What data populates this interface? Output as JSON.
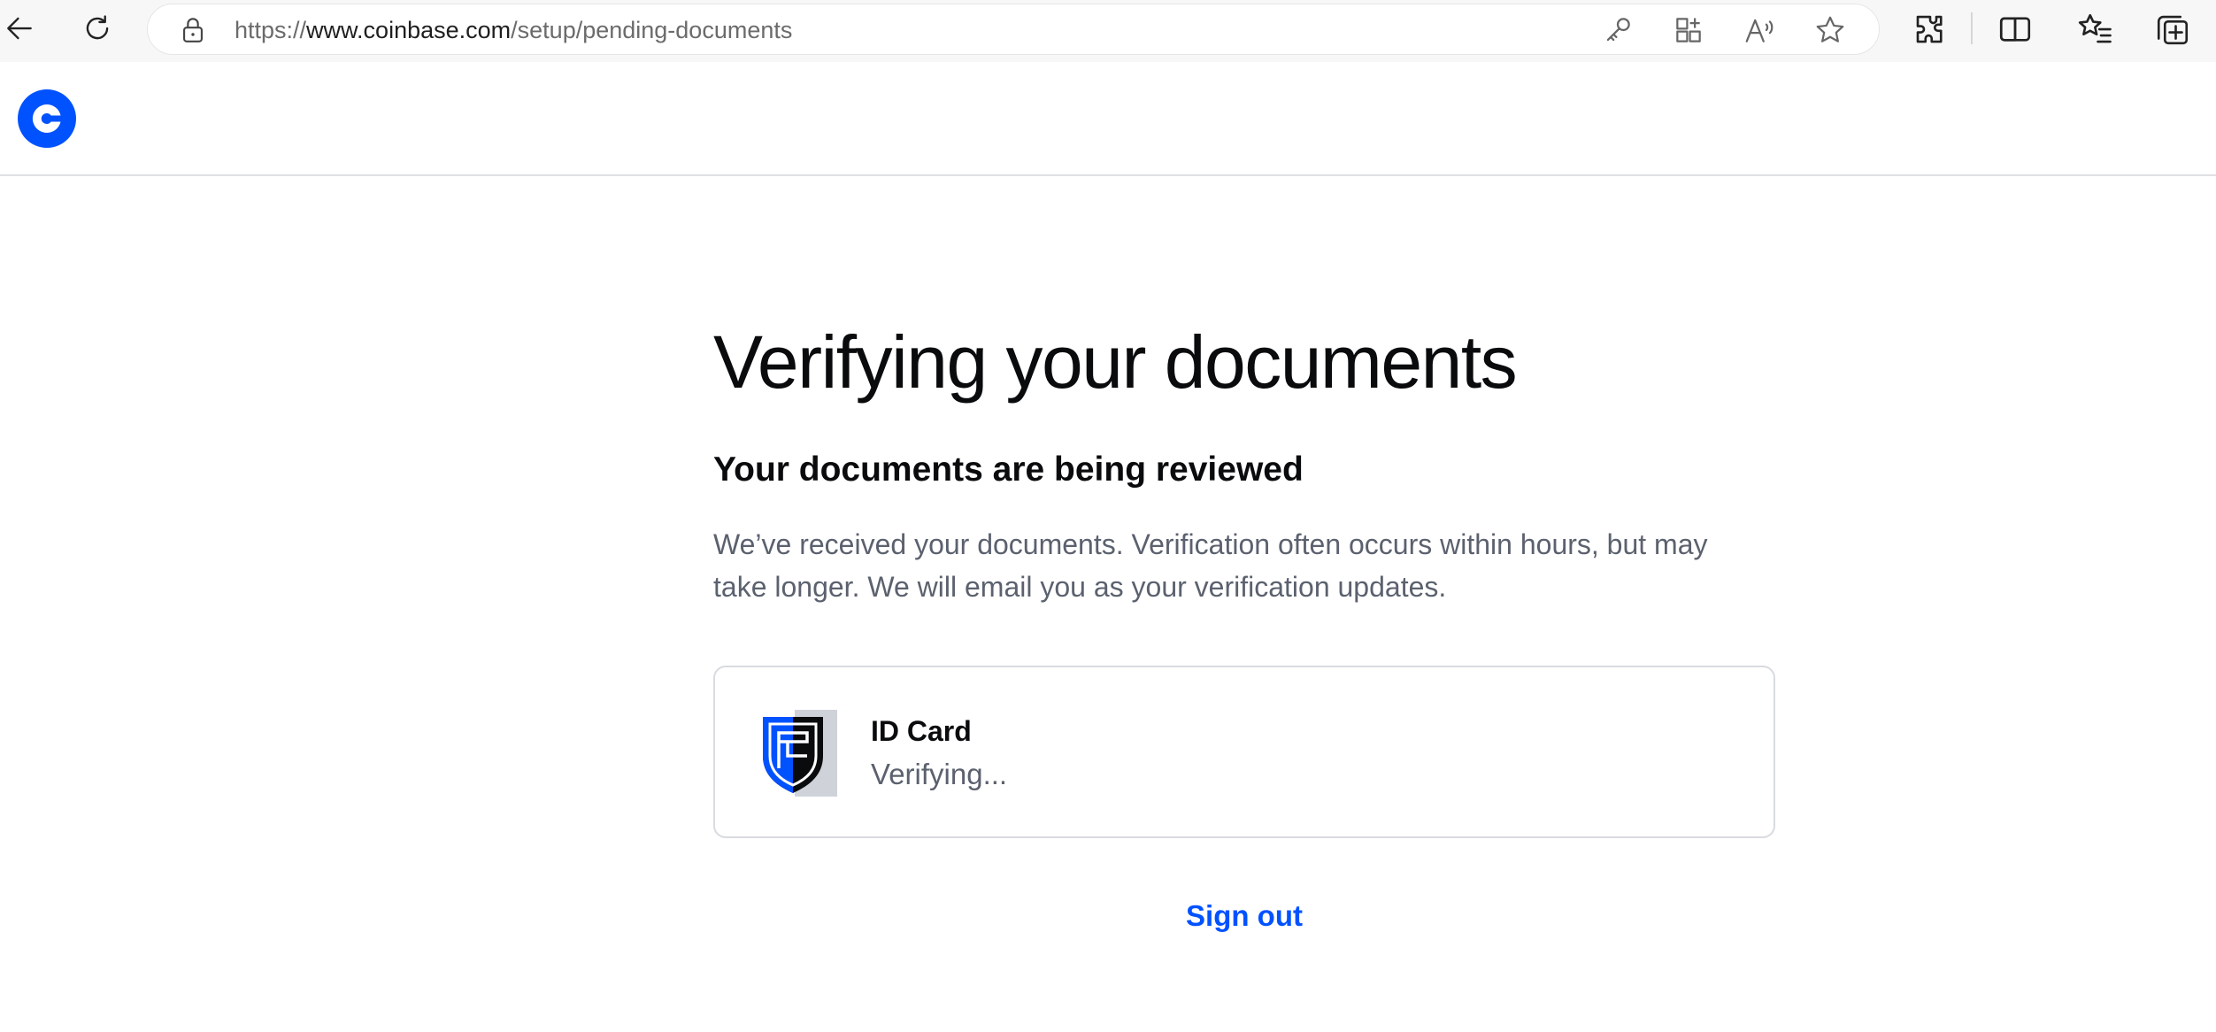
{
  "browser": {
    "url_scheme": "https://",
    "url_host": "www.coinbase.com",
    "url_path": "/setup/pending-documents",
    "icons": {
      "back": "back-arrow-icon",
      "reload": "reload-icon",
      "lock": "lock-icon",
      "password": "key-icon",
      "apps": "apps-icon",
      "read_aloud": "read-aloud-icon",
      "favorite": "star-icon",
      "extensions": "puzzle-icon",
      "split_screen": "split-screen-icon",
      "favorites": "favorites-list-icon",
      "collections": "collections-icon"
    }
  },
  "header": {
    "logo": "coinbase-logo"
  },
  "main": {
    "title": "Verifying your documents",
    "subtitle": "Your documents are being reviewed",
    "description": "We’ve received your documents. Verification often occurs within hours, but may take longer. We will email you as your verification updates.",
    "document": {
      "name": "ID Card",
      "status": "Verifying..."
    },
    "sign_out_label": "Sign out"
  },
  "colors": {
    "brand_blue": "#0052ff",
    "text_primary": "#0a0b0d",
    "text_secondary": "#5b616e",
    "border": "#d8dbe0"
  }
}
